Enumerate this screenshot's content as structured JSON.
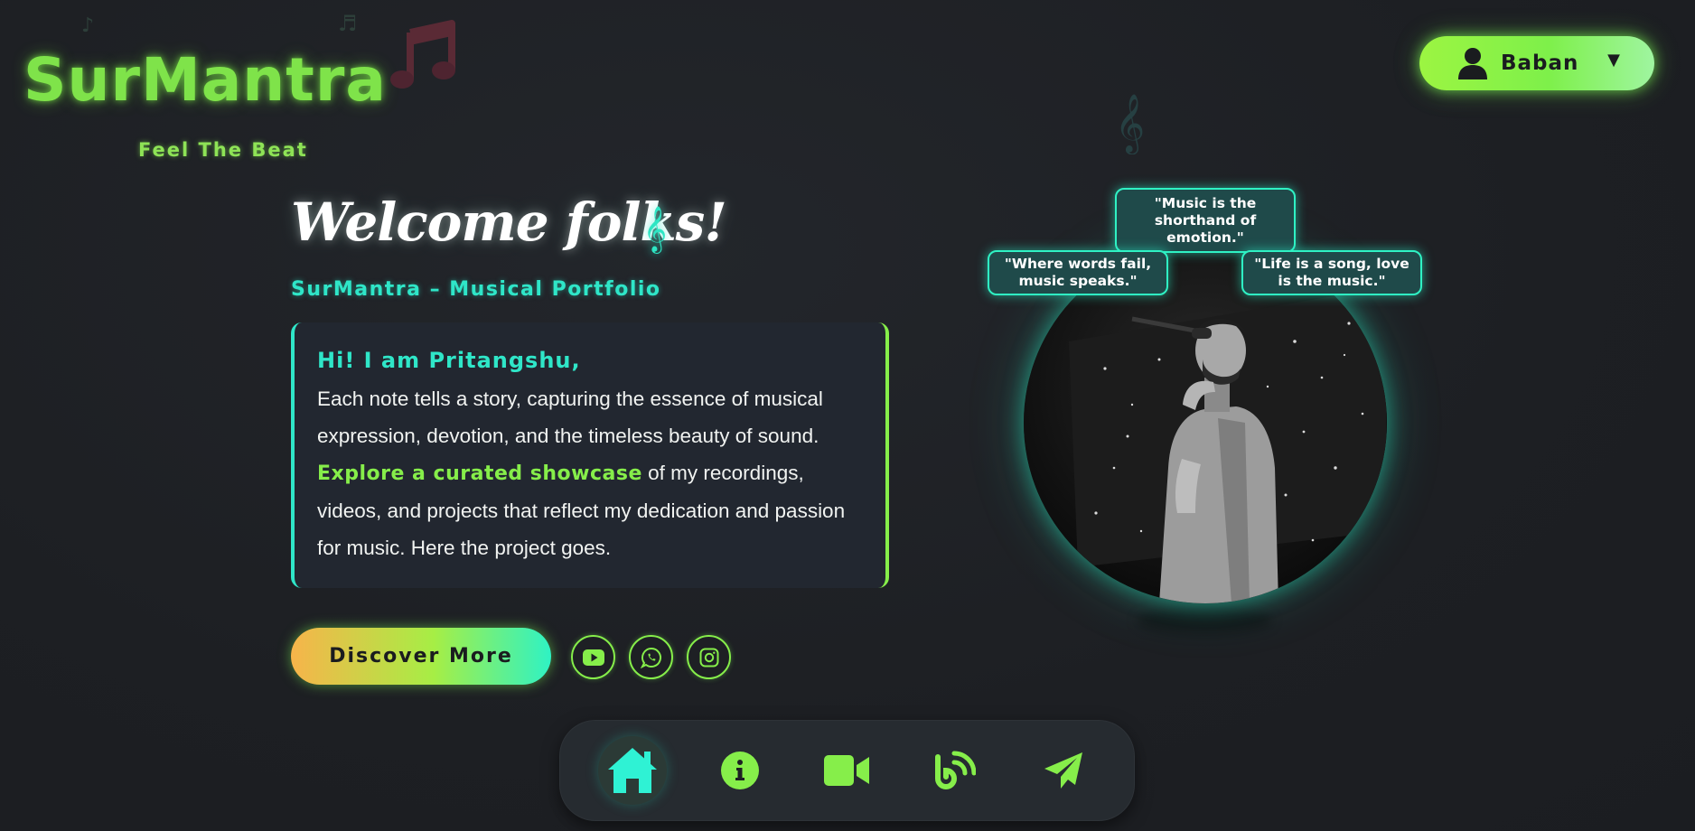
{
  "brand": {
    "name": "SurMantra",
    "tagline": "Feel The Beat"
  },
  "user_menu": {
    "name": "Baban",
    "caret": "▼"
  },
  "hero": {
    "welcome": "Welcome folks!",
    "subtitle": "SurMantra – Musical Portfolio",
    "greeting": "Hi! I am Pritangshu,",
    "paragraph1": "Each note tells a story, capturing the essence of musical expression, devotion, and the timeless beauty of sound.",
    "highlight": "Explore a curated showcase",
    "paragraph2": " of my recordings, videos, and projects that reflect my dedication and passion for music. Here the project goes.",
    "cta_label": "Discover More"
  },
  "social_links": [
    {
      "icon": "youtube-icon"
    },
    {
      "icon": "whatsapp-icon"
    },
    {
      "icon": "instagram-icon"
    }
  ],
  "quotes": {
    "top": "\"Music is the shorthand of emotion.\"",
    "left": "\"Where words fail, music speaks.\"",
    "right": "\"Life is a song, love is the music.\""
  },
  "bottom_nav": [
    {
      "icon": "home-icon",
      "active": true
    },
    {
      "icon": "info-icon",
      "active": false
    },
    {
      "icon": "video-camera-icon",
      "active": false
    },
    {
      "icon": "blog-rss-icon",
      "active": false
    },
    {
      "icon": "paper-plane-icon",
      "active": false
    }
  ],
  "colors": {
    "background": "#1d1f23",
    "neon_green": "#86ee4a",
    "neon_teal": "#2fe6c8",
    "card": "#222730"
  }
}
